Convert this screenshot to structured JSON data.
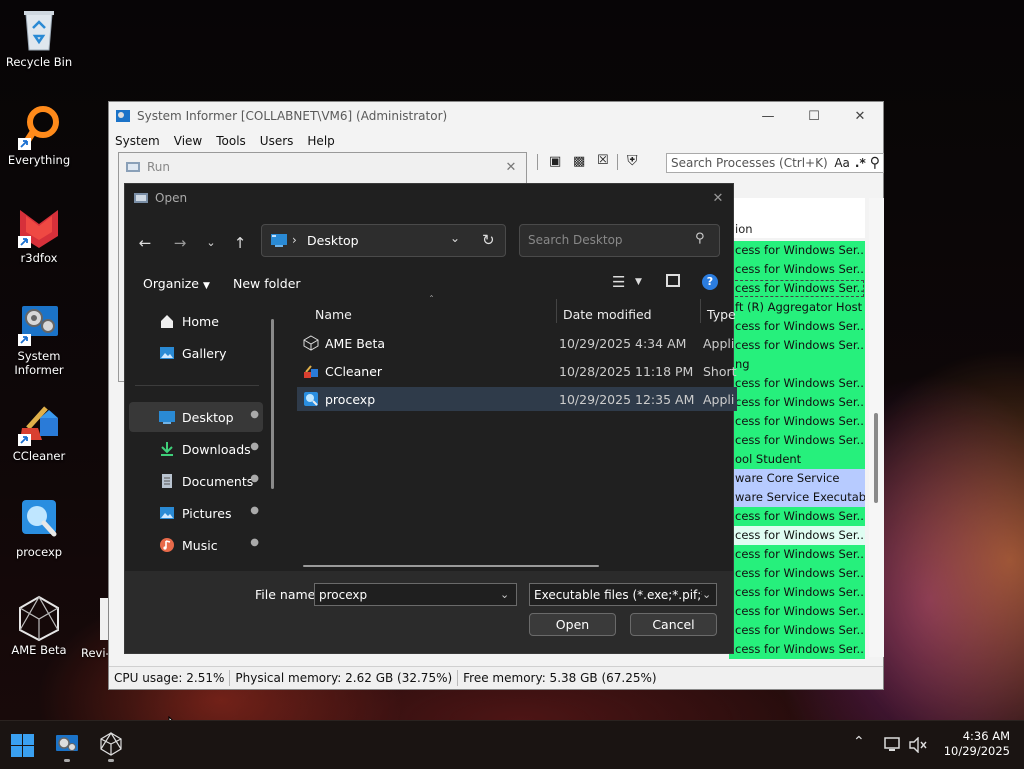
{
  "desktop": {
    "icons": [
      {
        "label": "Recycle Bin"
      },
      {
        "label": "Everything"
      },
      {
        "label": "r3dfox"
      },
      {
        "label": "System Informer"
      },
      {
        "label": "CCleaner"
      },
      {
        "label": "procexp"
      },
      {
        "label": "AME Beta"
      },
      {
        "label": "Revi-"
      }
    ]
  },
  "system_informer": {
    "title": "System Informer [COLLABNET\\VM6] (Administrator)",
    "menu": [
      "System",
      "View",
      "Tools",
      "Users",
      "Help"
    ],
    "search_placeholder": "Search Processes (Ctrl+K)",
    "search_case_label": "Aa",
    "search_regex_label": ".*",
    "column_header": "ion",
    "rows": [
      {
        "text": "cess for Windows Ser...",
        "color": "g"
      },
      {
        "text": "cess for Windows Ser...",
        "color": "g"
      },
      {
        "text": "cess for Windows Ser...",
        "color": "g"
      },
      {
        "text": "ft (R) Aggregator Host",
        "color": "g"
      },
      {
        "text": "cess for Windows Ser...",
        "color": "g"
      },
      {
        "text": "cess for Windows Ser...",
        "color": "g"
      },
      {
        "text": "ng",
        "color": "g"
      },
      {
        "text": "cess for Windows Ser...",
        "color": "g"
      },
      {
        "text": "cess for Windows Ser...",
        "color": "g"
      },
      {
        "text": "cess for Windows Ser...",
        "color": "g"
      },
      {
        "text": "cess for Windows Ser...",
        "color": "g"
      },
      {
        "text": "ool Student",
        "color": "g"
      },
      {
        "text": "ware Core Service",
        "color": "b"
      },
      {
        "text": "ware Service Executable",
        "color": "b"
      },
      {
        "text": "cess for Windows Ser...",
        "color": "g"
      },
      {
        "text": "cess for Windows Ser...",
        "color": "c"
      },
      {
        "text": "cess for Windows Ser...",
        "color": "g"
      },
      {
        "text": "cess for Windows Ser...",
        "color": "g"
      },
      {
        "text": "cess for Windows Ser...",
        "color": "g"
      },
      {
        "text": "cess for Windows Ser...",
        "color": "g"
      },
      {
        "text": "cess for Windows Ser...",
        "color": "g"
      },
      {
        "text": "cess for Windows Ser...",
        "color": "g"
      }
    ],
    "status": {
      "cpu": "CPU usage: 2.51%",
      "physical": "Physical memory: 2.62 GB (32.75%)",
      "free": "Free memory: 5.38 GB (67.25%)"
    }
  },
  "run_dialog": {
    "title": "Run"
  },
  "open_dialog": {
    "title": "Open",
    "address": "Desktop",
    "search_placeholder": "Search Desktop",
    "organize_label": "Organize",
    "new_folder_label": "New folder",
    "nav_items": [
      {
        "label": "Home",
        "icon": "home-icon"
      },
      {
        "label": "Gallery",
        "icon": "gallery-icon"
      },
      {
        "label": "Desktop",
        "icon": "desktop-folder-icon",
        "pinned": true,
        "selected": true
      },
      {
        "label": "Downloads",
        "icon": "downloads-icon",
        "pinned": true
      },
      {
        "label": "Documents",
        "icon": "documents-icon",
        "pinned": true
      },
      {
        "label": "Pictures",
        "icon": "pictures-icon",
        "pinned": true
      },
      {
        "label": "Music",
        "icon": "music-icon",
        "pinned": true
      }
    ],
    "columns": {
      "name": "Name",
      "date": "Date modified",
      "type": "Type"
    },
    "files": [
      {
        "name": "AME Beta",
        "date": "10/29/2025 4:34 AM",
        "type": "Appli"
      },
      {
        "name": "CCleaner",
        "date": "10/28/2025 11:18 PM",
        "type": "Short"
      },
      {
        "name": "procexp",
        "date": "10/29/2025 12:35 AM",
        "type": "Appli",
        "selected": true
      }
    ],
    "file_name_label": "File name:",
    "file_name_value": "procexp",
    "file_type_value": "Executable files (*.exe;*.pif;*.com",
    "open_label": "Open",
    "cancel_label": "Cancel"
  },
  "taskbar": {
    "time": "4:36 AM",
    "date": "10/29/2025"
  },
  "colors": {
    "row_green": "#26f07c",
    "row_blue": "#b7cbff",
    "row_cyan": "#dffdf2",
    "dialog_bg": "#202020"
  }
}
